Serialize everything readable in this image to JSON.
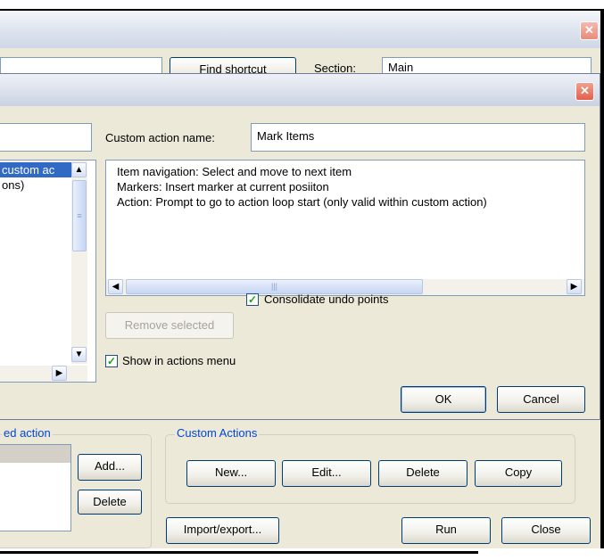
{
  "back_window": {
    "find_button_partial": "Find shortcut",
    "section_label_partial": "Section:",
    "section_value_partial": "Main",
    "group_left_legend": "ed action",
    "add_label": "Add...",
    "delete_left_label": "Delete",
    "custom_actions": {
      "legend": "Custom Actions",
      "new_label": "New...",
      "edit_label": "Edit...",
      "delete_label": "Delete",
      "copy_label": "Copy"
    },
    "import_export_label": "Import/export...",
    "run_label": "Run",
    "close_label": "Close"
  },
  "dialog": {
    "left_list_items": [
      "custom ac",
      "ons)"
    ],
    "custom_action_name_label": "Custom action name:",
    "custom_action_name_value": "Mark Items",
    "steps": [
      "Item navigation: Select and move to next item",
      "Markers: Insert marker at current posiiton",
      "Action: Prompt to go to action loop start (only valid within custom action)"
    ],
    "remove_selected_label": "Remove selected",
    "consolidate_label": "Consolidate undo points",
    "consolidate_checked": true,
    "show_in_menu_label": "Show in actions menu",
    "show_in_menu_checked": true,
    "ok_label": "OK",
    "cancel_label": "Cancel"
  },
  "icons": {
    "close": "close-icon",
    "scroll_up": "scroll-up-arrow-icon",
    "scroll_down": "scroll-down-arrow-icon",
    "scroll_left": "scroll-left-arrow-icon",
    "scroll_right": "scroll-right-arrow-icon",
    "checkmark": "checkmark-icon",
    "dropdown": "chevron-down-icon"
  },
  "colors": {
    "window_bg": "#ece9d8",
    "groupbox_legend": "#0046d5",
    "close_button": "#e2604a"
  }
}
